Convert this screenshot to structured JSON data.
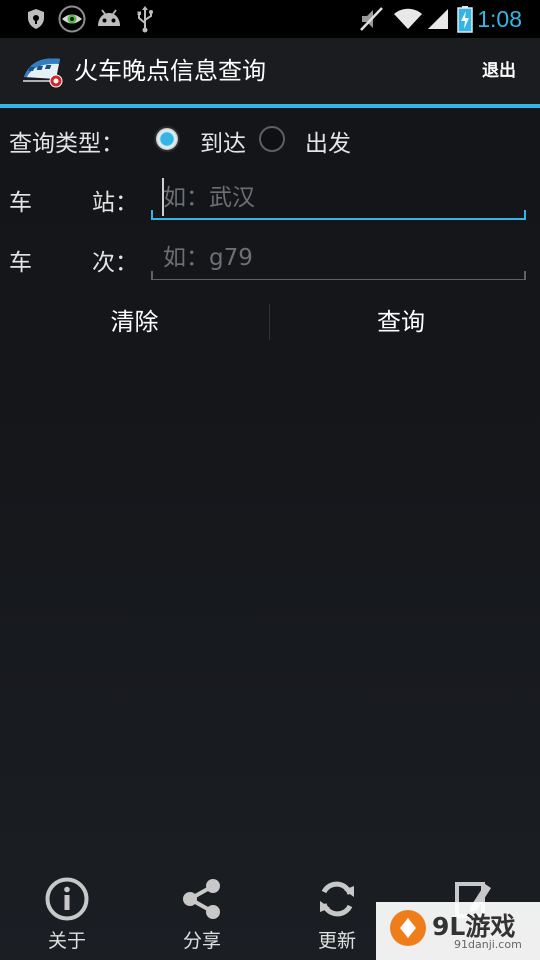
{
  "status_bar": {
    "time": "1:08",
    "accent_color": "#33b5e5",
    "left_icons": [
      "shield-icon",
      "eye-icon",
      "android-icon",
      "usb-icon"
    ],
    "right_icons": [
      "mute-icon",
      "wifi-icon",
      "signal-icon",
      "battery-charging-icon"
    ]
  },
  "action_bar": {
    "title": "火车晚点信息查询",
    "exit_label": "退出",
    "logo_icon": "train-logo-icon"
  },
  "form": {
    "query_type_label": "查询类型：",
    "option_arrive": "到达",
    "option_depart": "出发",
    "selected_option": "到达",
    "station_label_1": "车",
    "station_label_2": "站：",
    "station_placeholder": "如：武汉",
    "station_value": "",
    "train_label_1": "车",
    "train_label_2": "次：",
    "train_placeholder": "如：g79",
    "train_value": ""
  },
  "buttons": {
    "clear": "清除",
    "query": "查询"
  },
  "bottom_bar": {
    "items": [
      {
        "label": "关于",
        "icon": "info-icon"
      },
      {
        "label": "分享",
        "icon": "share-icon"
      },
      {
        "label": "更新",
        "icon": "refresh-icon"
      },
      {
        "label": "",
        "icon": "edit-icon"
      }
    ]
  },
  "watermark": {
    "main": "9L游戏",
    "sub": "91danji.com"
  }
}
